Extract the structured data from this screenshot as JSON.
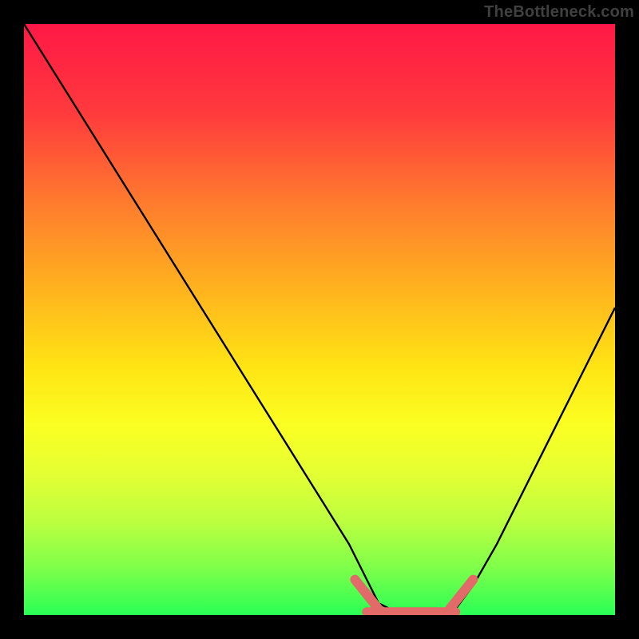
{
  "source_label": "TheBottleneck.com",
  "colors": {
    "frame": "#000000",
    "gradient_top": "#ff1846",
    "gradient_bottom": "#29ff55",
    "curve": "#000000",
    "marker": "#e26a69"
  },
  "chart_data": {
    "type": "line",
    "title": "",
    "xlabel": "",
    "ylabel": "",
    "xlim": [
      0,
      100
    ],
    "ylim": [
      0,
      100
    ],
    "series": [
      {
        "name": "curve",
        "x": [
          0,
          5,
          10,
          15,
          20,
          25,
          30,
          35,
          40,
          45,
          50,
          55,
          58,
          60,
          64,
          68,
          71,
          73,
          76,
          80,
          84,
          88,
          92,
          96,
          100
        ],
        "y": [
          100,
          92,
          84,
          76,
          68,
          60,
          52,
          44,
          36,
          28,
          20,
          12,
          6,
          2,
          0,
          0,
          0,
          1,
          5,
          12,
          20,
          28,
          36,
          44,
          52
        ]
      }
    ],
    "markers": [
      {
        "name": "flat-left-end",
        "x": 58,
        "y": 3
      },
      {
        "name": "flat-right-end",
        "x": 73,
        "y": 3
      },
      {
        "name": "flat-mid",
        "x": 65,
        "y": 0
      }
    ]
  }
}
